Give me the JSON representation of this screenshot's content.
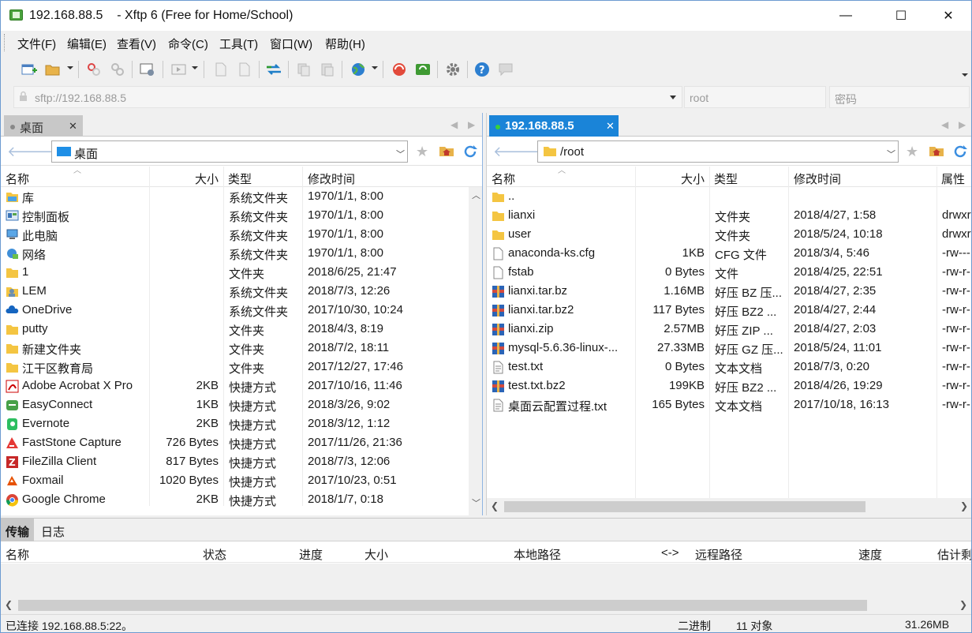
{
  "window": {
    "title": "192.168.88.5    - Xftp 6 (Free for Home/School)",
    "controls": {
      "minimize": "—",
      "maximize": "☐",
      "close": "✕"
    }
  },
  "menu": [
    "文件(F)",
    "编辑(E)",
    "查看(V)",
    "命令(C)",
    "工具(T)",
    "窗口(W)",
    "帮助(H)"
  ],
  "toolbar": {
    "icons": [
      "new-session-icon",
      "open-folder-icon",
      "disconnect-icon",
      "reconnect-icon",
      "session-properties-icon",
      "terminal-icon",
      "upload-icon",
      "download-icon",
      "transfer-icon",
      "copy-icon",
      "paste-icon",
      "globe-icon",
      "xshell-icon",
      "xftp-icon",
      "settings-icon",
      "help-icon",
      "chat-icon"
    ]
  },
  "address": {
    "url": "sftp://192.168.88.5",
    "user_placeholder": "root",
    "password_placeholder": "密码"
  },
  "left_pane": {
    "tab_label": "桌面",
    "path": "桌面",
    "columns": [
      "名称",
      "大小",
      "类型",
      "修改时间"
    ],
    "rows": [
      {
        "icon": "library-icon",
        "name": "库",
        "size": "",
        "type": "系统文件夹",
        "modified": "1970/1/1, 8:00"
      },
      {
        "icon": "control-panel-icon",
        "name": "控制面板",
        "size": "",
        "type": "系统文件夹",
        "modified": "1970/1/1, 8:00"
      },
      {
        "icon": "computer-icon",
        "name": "此电脑",
        "size": "",
        "type": "系统文件夹",
        "modified": "1970/1/1, 8:00"
      },
      {
        "icon": "network-icon",
        "name": "网络",
        "size": "",
        "type": "系统文件夹",
        "modified": "1970/1/1, 8:00"
      },
      {
        "icon": "folder-icon",
        "name": "1",
        "size": "",
        "type": "文件夹",
        "modified": "2018/6/25, 21:47"
      },
      {
        "icon": "user-folder-icon",
        "name": "LEM",
        "size": "",
        "type": "系统文件夹",
        "modified": "2018/7/3, 12:26"
      },
      {
        "icon": "onedrive-icon",
        "name": "OneDrive",
        "size": "",
        "type": "系统文件夹",
        "modified": "2017/10/30, 10:24"
      },
      {
        "icon": "folder-icon",
        "name": "putty",
        "size": "",
        "type": "文件夹",
        "modified": "2018/4/3, 8:19"
      },
      {
        "icon": "folder-icon",
        "name": "新建文件夹",
        "size": "",
        "type": "文件夹",
        "modified": "2018/7/2, 18:11"
      },
      {
        "icon": "folder-icon",
        "name": "江干区教育局",
        "size": "",
        "type": "文件夹",
        "modified": "2017/12/27, 17:46"
      },
      {
        "icon": "acrobat-icon",
        "name": "Adobe Acrobat X Pro",
        "size": "2KB",
        "type": "快捷方式",
        "modified": "2017/10/16, 11:46"
      },
      {
        "icon": "easyconnect-icon",
        "name": "EasyConnect",
        "size": "1KB",
        "type": "快捷方式",
        "modified": "2018/3/26, 9:02"
      },
      {
        "icon": "evernote-icon",
        "name": "Evernote",
        "size": "2KB",
        "type": "快捷方式",
        "modified": "2018/3/12, 1:12"
      },
      {
        "icon": "faststone-icon",
        "name": "FastStone Capture",
        "size": "726 Bytes",
        "type": "快捷方式",
        "modified": "2017/11/26, 21:36"
      },
      {
        "icon": "filezilla-icon",
        "name": "FileZilla Client",
        "size": "817 Bytes",
        "type": "快捷方式",
        "modified": "2018/7/3, 12:06"
      },
      {
        "icon": "foxmail-icon",
        "name": "Foxmail",
        "size": "1020 Bytes",
        "type": "快捷方式",
        "modified": "2017/10/23, 0:51"
      },
      {
        "icon": "chrome-icon",
        "name": "Google Chrome",
        "size": "2KB",
        "type": "快捷方式",
        "modified": "2018/1/7, 0:18"
      }
    ]
  },
  "right_pane": {
    "tab_label": "192.168.88.5",
    "path": "/root",
    "columns": [
      "名称",
      "大小",
      "类型",
      "修改时间",
      "属性"
    ],
    "rows": [
      {
        "icon": "folder-icon",
        "name": "..",
        "size": "",
        "type": "",
        "modified": "",
        "attr": ""
      },
      {
        "icon": "folder-icon",
        "name": "lianxi",
        "size": "",
        "type": "文件夹",
        "modified": "2018/4/27, 1:58",
        "attr": "drwxr"
      },
      {
        "icon": "folder-icon",
        "name": "user",
        "size": "",
        "type": "文件夹",
        "modified": "2018/5/24, 10:18",
        "attr": "drwxr"
      },
      {
        "icon": "file-icon",
        "name": "anaconda-ks.cfg",
        "size": "1KB",
        "type": "CFG 文件",
        "modified": "2018/3/4, 5:46",
        "attr": "-rw---"
      },
      {
        "icon": "file-icon",
        "name": "fstab",
        "size": "0 Bytes",
        "type": "文件",
        "modified": "2018/4/25, 22:51",
        "attr": "-rw-r-"
      },
      {
        "icon": "archive-icon",
        "name": "lianxi.tar.bz",
        "size": "1.16MB",
        "type": "好压 BZ 压...",
        "modified": "2018/4/27, 2:35",
        "attr": "-rw-r-"
      },
      {
        "icon": "archive-icon",
        "name": "lianxi.tar.bz2",
        "size": "117 Bytes",
        "type": "好压 BZ2 ...",
        "modified": "2018/4/27, 2:44",
        "attr": "-rw-r-"
      },
      {
        "icon": "archive-icon",
        "name": "lianxi.zip",
        "size": "2.57MB",
        "type": "好压 ZIP ...",
        "modified": "2018/4/27, 2:03",
        "attr": "-rw-r-"
      },
      {
        "icon": "archive-icon",
        "name": "mysql-5.6.36-linux-...",
        "size": "27.33MB",
        "type": "好压 GZ 压...",
        "modified": "2018/5/24, 11:01",
        "attr": "-rw-r-"
      },
      {
        "icon": "text-file-icon",
        "name": "test.txt",
        "size": "0 Bytes",
        "type": "文本文档",
        "modified": "2018/7/3, 0:20",
        "attr": "-rw-r-"
      },
      {
        "icon": "archive-icon",
        "name": "test.txt.bz2",
        "size": "199KB",
        "type": "好压 BZ2 ...",
        "modified": "2018/4/26, 19:29",
        "attr": "-rw-r-"
      },
      {
        "icon": "text-file-icon",
        "name": "桌面云配置过程.txt",
        "size": "165 Bytes",
        "type": "文本文档",
        "modified": "2017/10/18, 16:13",
        "attr": "-rw-r-"
      }
    ]
  },
  "transfer": {
    "tabs": [
      "传输",
      "日志"
    ],
    "columns": [
      "名称",
      "状态",
      "进度",
      "大小",
      "本地路径",
      "<->",
      "远程路径",
      "速度",
      "估计剩"
    ]
  },
  "status": {
    "connection": "已连接 192.168.88.5:22。",
    "mode": "二进制",
    "objects": "11 对象",
    "size": "31.26MB"
  },
  "colors": {
    "accent": "#1a84d8",
    "selection_border": "#8fb4e2",
    "folder": "#f4c542"
  }
}
